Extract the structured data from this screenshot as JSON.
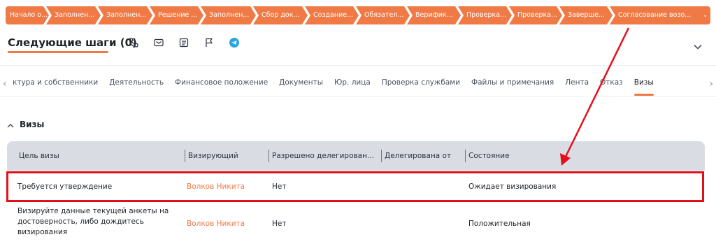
{
  "stages": [
    "Начало о...",
    "Заполнен...",
    "Заполнен...",
    "Решение ...",
    "Заполнен...",
    "Сбор док...",
    "Создание...",
    "Обязател...",
    "Верифик...",
    "Проверка...",
    "Проверка...",
    "Заверше...",
    "Согласование возо..."
  ],
  "next_steps": {
    "title": "Следующие шаги (0)"
  },
  "tabs": [
    "ктура и собственники",
    "Деятельность",
    "Финансовое положение",
    "Документы",
    "Юр. лица",
    "Проверка службами",
    "Файлы и примечания",
    "Лента",
    "Отказ",
    "Визы"
  ],
  "section": {
    "title": "Визы"
  },
  "table": {
    "headers": [
      "Цель визы",
      "Визирующий",
      "Разрешено делегирован...",
      "Делегирована от",
      "Состояние"
    ],
    "rows": [
      {
        "purpose": "Требуется утверждение",
        "approver": "Волков Никита",
        "delegation_allowed": "Нет",
        "delegated_from": "",
        "status": "Ожидает визирования"
      },
      {
        "purpose": "Визируйте данные текущей анкеты на достоверность, либо дождитесь визирования",
        "approver": "Волков Никита",
        "delegation_allowed": "Нет",
        "delegated_from": "",
        "status": "Положительная"
      }
    ]
  },
  "colors": {
    "accent": "#f07a45",
    "annotation": "#e3101c",
    "header_bg": "#d9dde3"
  },
  "icons": [
    "phone-icon",
    "mail-icon",
    "document-icon",
    "flag-icon",
    "telegram-icon",
    "chevron-down-icon",
    "chevron-left-icon",
    "chevron-right-icon",
    "chevron-up-icon"
  ]
}
